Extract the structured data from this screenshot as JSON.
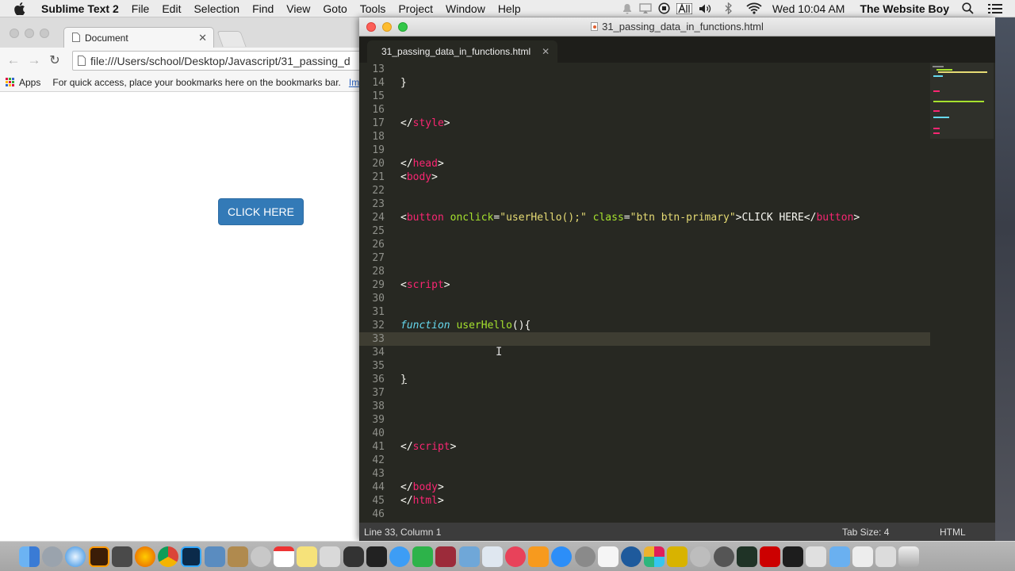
{
  "menubar": {
    "app_name": "Sublime Text 2",
    "items": [
      "File",
      "Edit",
      "Selection",
      "Find",
      "View",
      "Goto",
      "Tools",
      "Project",
      "Window",
      "Help"
    ],
    "clock": "Wed 10:04 AM",
    "user": "The Website Boy",
    "status_icons": [
      "notification-icon",
      "airplay-icon",
      "record-icon",
      "text-icon",
      "volume-icon",
      "bluetooth-icon",
      "wifi-icon",
      "spotlight-icon",
      "list-icon"
    ]
  },
  "browser": {
    "tab_title": "Document",
    "url": "file:///Users/school/Desktop/Javascript/31_passing_d",
    "bookmarks": {
      "apps_label": "Apps",
      "hint": "For quick access, place your bookmarks here on the bookmarks bar.",
      "import_link": "Im"
    },
    "page": {
      "button_label": "CLICK HERE"
    }
  },
  "editor": {
    "window_title": "31_passing_data_in_functions.html",
    "tab_label": "31_passing_data_in_functions.html",
    "line_numbers": [
      "13",
      "14",
      "15",
      "16",
      "17",
      "18",
      "19",
      "20",
      "21",
      "22",
      "23",
      "24",
      "25",
      "26",
      "27",
      "28",
      "29",
      "30",
      "31",
      "32",
      "33",
      "34",
      "35",
      "36",
      "37",
      "38",
      "39",
      "40",
      "41",
      "42",
      "43",
      "44",
      "45",
      "46"
    ],
    "code": {
      "l14_brace": "}",
      "l17_open": "</",
      "l17_tag": "style",
      "l17_close": ">",
      "l20_open": "</",
      "l20_tag": "head",
      "l20_close": ">",
      "l21_open": "<",
      "l21_tag": "body",
      "l21_close": ">",
      "l24_open": "<",
      "l24_tag": "button",
      "l24_attr1": "onclick",
      "l24_eq1": "=",
      "l24_val1": "\"userHello();\"",
      "l24_attr2": "class",
      "l24_eq2": "=",
      "l24_val2": "\"btn btn-primary\"",
      "l24_text": ">CLICK HERE</",
      "l24_tag2": "button",
      "l24_close": ">",
      "l29_open": "<",
      "l29_tag": "script",
      "l29_close": ">",
      "l32_kw": "function",
      "l32_fn": "userHello",
      "l32_rest": "(){",
      "l36_brace": "}",
      "l41_open": "</",
      "l41_tag": "script",
      "l41_close": ">",
      "l44_open": "</",
      "l44_tag": "body",
      "l44_close": ">",
      "l45_open": "</",
      "l45_tag": "html",
      "l45_close": ">"
    },
    "status": {
      "position": "Line 33, Column 1",
      "tab_size": "Tab Size: 4",
      "syntax": "HTML"
    },
    "colors": {
      "background": "#272822",
      "tag": "#f92672",
      "attribute": "#a6e22e",
      "string": "#e6db74",
      "keyword": "#66d9ef",
      "line_number": "#8f908a"
    }
  },
  "dock": {
    "apps": [
      "finder",
      "launchpad",
      "safari",
      "illustrator",
      "sublime-text",
      "firefox",
      "chrome",
      "photoshop",
      "preview",
      "archive",
      "help",
      "calendar",
      "notes",
      "photo-booth",
      "game-center",
      "terminal",
      "messages",
      "facetime",
      "photos",
      "itunes-alt",
      "preview-app",
      "keynote",
      "itunes",
      "ibooks",
      "app-store",
      "system-preferences",
      "textedit",
      "quicktime",
      "slack",
      "winamp",
      "settings",
      "github",
      "activity-monitor",
      "acrobat",
      "kindle",
      "pages",
      "folder",
      "drive",
      "trash"
    ]
  }
}
